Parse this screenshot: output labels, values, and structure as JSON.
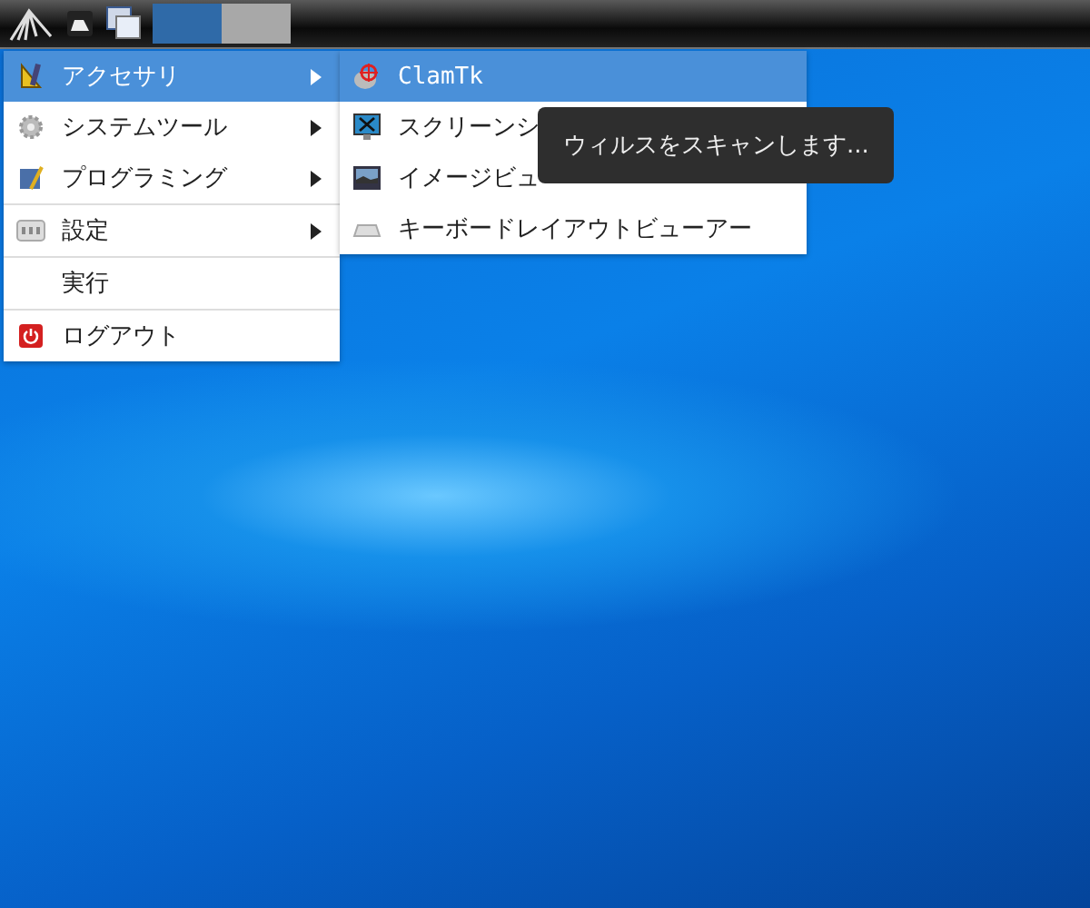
{
  "taskbar": {
    "tasks": [
      {
        "selected": true
      },
      {
        "selected": false
      }
    ]
  },
  "menu": {
    "groups": [
      [
        {
          "label": "アクセサリ",
          "submenu": true,
          "selected": true
        },
        {
          "label": "システムツール",
          "submenu": true,
          "selected": false
        },
        {
          "label": "プログラミング",
          "submenu": true,
          "selected": false
        }
      ],
      [
        {
          "label": "設定",
          "submenu": true,
          "selected": false
        }
      ],
      [
        {
          "label": "実行",
          "submenu": false,
          "selected": false
        }
      ],
      [
        {
          "label": "ログアウト",
          "submenu": false,
          "selected": false
        }
      ]
    ]
  },
  "submenu": {
    "items": [
      {
        "label": "ClamTk",
        "selected": true
      },
      {
        "label": "スクリーンシ",
        "selected": false
      },
      {
        "label": "イメージビュ",
        "selected": false
      },
      {
        "label": "キーボードレイアウトビューアー",
        "selected": false
      }
    ]
  },
  "tooltip": {
    "text": "ウィルスをスキャンします..."
  }
}
